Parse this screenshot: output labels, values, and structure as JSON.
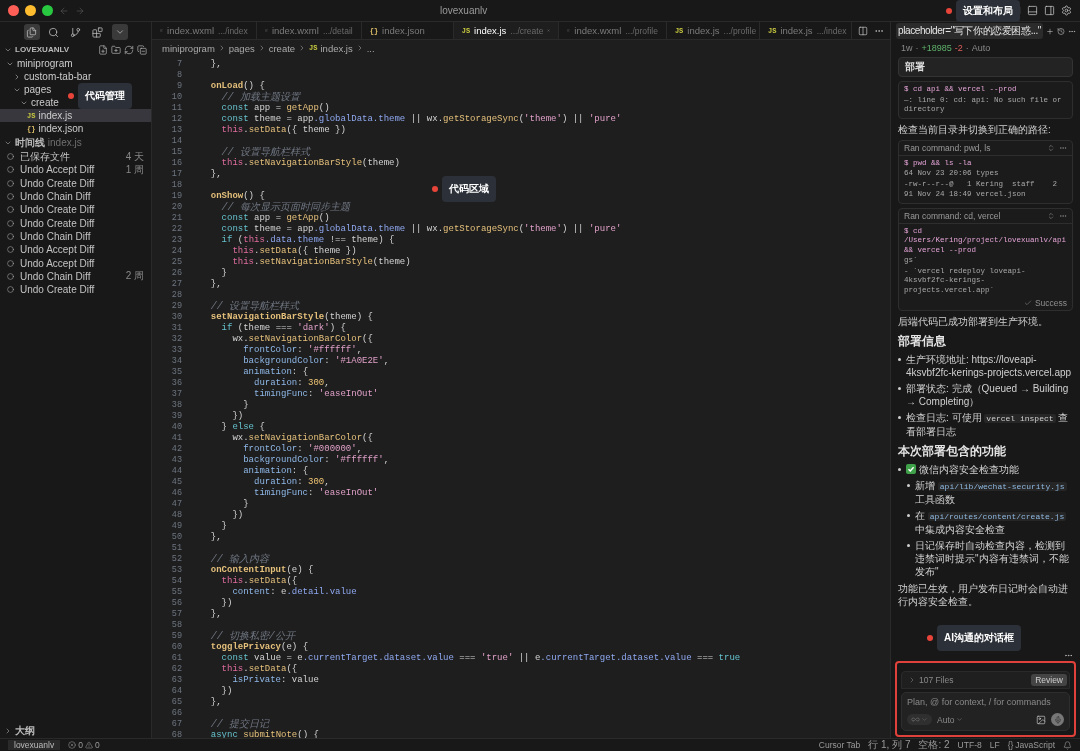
{
  "window": {
    "title": "lovexuanlv"
  },
  "sidebar": {
    "explorer_title": "LOVEXUANLV",
    "callout": "代码管理",
    "tree": [
      {
        "name": "miniprogram",
        "kind": "folder",
        "expanded": true,
        "children": [
          {
            "name": "custom-tab-bar",
            "kind": "folder",
            "expanded": false
          },
          {
            "name": "pages",
            "kind": "folder",
            "expanded": true,
            "children": [
              {
                "name": "create",
                "kind": "folder",
                "expanded": true,
                "children": [
                  {
                    "name": "index.js",
                    "kind": "js",
                    "icon_text": "JS",
                    "selected": true
                  },
                  {
                    "name": "index.json",
                    "kind": "json",
                    "icon_text": "{}",
                    "selected": false
                  }
                ]
              }
            ]
          }
        ]
      }
    ],
    "timeline": {
      "title": "时间线",
      "file": "index.js",
      "items": [
        {
          "label": "已保存文件",
          "time": "4 天"
        },
        {
          "label": "Undo Accept Diff",
          "time": "1 周"
        },
        {
          "label": "Undo Create Diff"
        },
        {
          "label": "Undo Chain Diff"
        },
        {
          "label": "Undo Create Diff"
        },
        {
          "label": "Undo Create Diff"
        },
        {
          "label": "Undo Chain Diff"
        },
        {
          "label": "Undo Accept Diff"
        },
        {
          "label": "Undo Accept Diff"
        },
        {
          "label": "Undo Chain Diff",
          "time": "2 周"
        },
        {
          "label": "Undo Create Diff"
        }
      ]
    },
    "outline": {
      "title": "大纲"
    }
  },
  "editor": {
    "callout": "代码区域",
    "tabs": [
      {
        "name": "index.wxml",
        "path": ".../index",
        "kind": "wxml",
        "selected": false
      },
      {
        "name": "index.wxml",
        "path": ".../detail",
        "kind": "wxml",
        "selected": false
      },
      {
        "name": "index.json",
        "kind": "json",
        "icon_text": "{}",
        "selected": false
      },
      {
        "name": "index.js",
        "path": ".../create",
        "kind": "js",
        "icon_text": "JS",
        "selected": true
      },
      {
        "name": "index.wxml",
        "path": ".../profile",
        "kind": "wxml",
        "selected": false
      },
      {
        "name": "index.js",
        "path": ".../profile",
        "kind": "js",
        "icon_text": "JS",
        "selected": false
      },
      {
        "name": "index.js",
        "path": ".../index",
        "kind": "js",
        "icon_text": "JS",
        "selected": false
      }
    ],
    "breadcrumb": [
      {
        "label": "miniprogram"
      },
      {
        "label": "pages"
      },
      {
        "label": "create"
      },
      {
        "label": "index.js",
        "icon_text": "JS"
      },
      {
        "label": "..."
      }
    ],
    "lines": [
      {
        "n": "7",
        "code": "  },"
      },
      {
        "n": "8"
      },
      {
        "n": "9",
        "code": "  onLoad() {"
      },
      {
        "n": "10",
        "code": "    // 加载主题设置"
      },
      {
        "n": "11",
        "code": "    const app = getApp()"
      },
      {
        "n": "12",
        "code": "    const theme = app.globalData.theme || wx.getStorageSync('theme') || 'pure'"
      },
      {
        "n": "13",
        "code": "    this.setData({ theme })"
      },
      {
        "n": "14"
      },
      {
        "n": "15",
        "code": "    // 设置导航栏样式"
      },
      {
        "n": "16",
        "code": "    this.setNavigationBarStyle(theme)"
      },
      {
        "n": "17",
        "code": "  },"
      },
      {
        "n": "18"
      },
      {
        "n": "19",
        "code": "  onShow() {"
      },
      {
        "n": "20",
        "code": "    // 每次显示页面时同步主题"
      },
      {
        "n": "21",
        "code": "    const app = getApp()"
      },
      {
        "n": "22",
        "code": "    const theme = app.globalData.theme || wx.getStorageSync('theme') || 'pure'"
      },
      {
        "n": "23",
        "code": "    if (this.data.theme !== theme) {"
      },
      {
        "n": "24",
        "code": "      this.setData({ theme })"
      },
      {
        "n": "25",
        "code": "      this.setNavigationBarStyle(theme)"
      },
      {
        "n": "26",
        "code": "    }"
      },
      {
        "n": "27",
        "code": "  },"
      },
      {
        "n": "28"
      },
      {
        "n": "29",
        "code": "  // 设置导航栏样式"
      },
      {
        "n": "30",
        "code": "  setNavigationBarStyle(theme) {"
      },
      {
        "n": "31",
        "code": "    if (theme === 'dark') {"
      },
      {
        "n": "32",
        "code": "      wx.setNavigationBarColor({"
      },
      {
        "n": "33",
        "code": "        frontColor: '#ffffff',"
      },
      {
        "n": "34",
        "code": "        backgroundColor: '#1A0E2E',"
      },
      {
        "n": "35",
        "code": "        animation: {"
      },
      {
        "n": "36",
        "code": "          duration: 300,"
      },
      {
        "n": "37",
        "code": "          timingFunc: 'easeInOut'"
      },
      {
        "n": "38",
        "code": "        }"
      },
      {
        "n": "39",
        "code": "      })"
      },
      {
        "n": "40",
        "code": "    } else {"
      },
      {
        "n": "41",
        "code": "      wx.setNavigationBarColor({"
      },
      {
        "n": "42",
        "code": "        frontColor: '#000000',"
      },
      {
        "n": "43",
        "code": "        backgroundColor: '#ffffff',"
      },
      {
        "n": "44",
        "code": "        animation: {"
      },
      {
        "n": "45",
        "code": "          duration: 300,"
      },
      {
        "n": "46",
        "code": "          timingFunc: 'easeInOut'"
      },
      {
        "n": "47",
        "code": "        }"
      },
      {
        "n": "48",
        "code": "      })"
      },
      {
        "n": "49",
        "code": "    }"
      },
      {
        "n": "50",
        "code": "  },"
      },
      {
        "n": "51"
      },
      {
        "n": "52",
        "code": "  // 输入内容"
      },
      {
        "n": "53",
        "code": "  onContentInput(e) {"
      },
      {
        "n": "54",
        "code": "    this.setData({"
      },
      {
        "n": "55",
        "code": "      content: e.detail.value"
      },
      {
        "n": "56",
        "code": "    })"
      },
      {
        "n": "57",
        "code": "  },"
      },
      {
        "n": "58"
      },
      {
        "n": "59",
        "code": "  // 切换私密/公开"
      },
      {
        "n": "60",
        "code": "  togglePrivacy(e) {"
      },
      {
        "n": "61",
        "code": "    const value = e.currentTarget.dataset.value === 'true' || e.currentTarget.dataset.value === true"
      },
      {
        "n": "62",
        "code": "    this.setData({"
      },
      {
        "n": "63",
        "code": "      isPrivate: value"
      },
      {
        "n": "64",
        "code": "    })"
      },
      {
        "n": "65",
        "code": "  },"
      },
      {
        "n": "66"
      },
      {
        "n": "67",
        "code": "  // 提交日记"
      },
      {
        "n": "68",
        "code": "  async submitNote() {"
      }
    ]
  },
  "chat": {
    "header_callout": "设置和布局",
    "tab": "placeholder=\"写下你的恋爱困惑...\"",
    "meta": {
      "age": "1w",
      "separator": "·",
      "added": "+18985",
      "removed": "-2",
      "mode": "Auto"
    },
    "sticky_title": "部署",
    "blocks": [
      {
        "kind": "terminal",
        "lines": [
          {
            "kind": "command",
            "text": "$ cd api && vercel --prod"
          },
          {
            "kind": "output",
            "text": "—: line 0: cd: api: No such file or directory"
          }
        ]
      },
      {
        "kind": "text",
        "text": "检查当前目录并切换到正确的路径:"
      },
      {
        "kind": "command",
        "title": "Ran command: pwd, ls",
        "lines": [
          {
            "kind": "command",
            "text": "$ pwd && ls -la"
          },
          {
            "kind": "output",
            "text": "64 Nov 23 20:06 types"
          },
          {
            "kind": "output",
            "text": "-rw-r--r--@   1 Kering  staff    2"
          },
          {
            "kind": "output",
            "text": "91 Nov 24 18:49 vercel.json"
          }
        ]
      },
      {
        "kind": "command",
        "title": "Ran command: cd, vercel",
        "lines": [
          {
            "kind": "command",
            "text": "$ cd /Users/Kering/project/lovexuanlv/api && vercel --prod"
          },
          {
            "kind": "output",
            "text": "gs`"
          },
          {
            "kind": "output",
            "text": "- `vercel redeploy loveapi-4ksvbf2fc-kerings-projects.vercel.app`"
          }
        ],
        "status": "Success"
      },
      {
        "kind": "text",
        "text": "后端代码已成功部署到生产环境。"
      },
      {
        "kind": "heading",
        "text": "部署信息"
      },
      {
        "kind": "list",
        "items": [
          {
            "parts": [
              {
                "kind": "text",
                "text": "生产环境地址: https://loveapi-4ksvbf2fc-kerings-projects.vercel.app"
              }
            ]
          },
          {
            "parts": [
              {
                "kind": "text",
                "text": "部署状态: 完成（Queued → Building → Completing）"
              }
            ]
          },
          {
            "parts": [
              {
                "kind": "text",
                "text": "检查日志: 可使用 "
              },
              {
                "kind": "code",
                "text": "vercel inspect"
              },
              {
                "kind": "text",
                "text": " 查看部署日志"
              }
            ]
          }
        ]
      },
      {
        "kind": "heading",
        "text": "本次部署包含的功能"
      },
      {
        "kind": "list",
        "items": [
          {
            "parts": [
              {
                "kind": "check"
              },
              {
                "kind": "text",
                "text": "微信内容安全检查功能"
              }
            ],
            "children": [
              {
                "parts": [
                  {
                    "kind": "text",
                    "text": "新增 "
                  },
                  {
                    "kind": "code",
                    "text": "api/lib/wechat-security.js"
                  },
                  {
                    "kind": "text",
                    "text": " 工具函数"
                  }
                ]
              },
              {
                "parts": [
                  {
                    "kind": "text",
                    "text": "在 "
                  },
                  {
                    "kind": "code",
                    "text": "api/routes/content/create.js"
                  },
                  {
                    "kind": "text",
                    "text": " 中集成内容安全检查"
                  }
                ]
              },
              {
                "parts": [
                  {
                    "kind": "text",
                    "text": "日记保存时自动检查内容，检测到违禁词时提示\"内容有违禁词，不能发布\""
                  }
                ]
              }
            ]
          }
        ]
      },
      {
        "kind": "text",
        "text": "功能已生效，用户发布日记时会自动进行内容安全检查。"
      }
    ],
    "callout": "AI沟通的对话框",
    "composer": {
      "files": "107 Files",
      "review": "Review",
      "placeholder": "Plan, @ for context, / for commands",
      "mode": "Auto",
      "highlighted": true
    }
  },
  "status_bar": {
    "workspace": "lovexuanlv",
    "errors": "0",
    "warnings": "0",
    "items": [
      {
        "text": "Cursor Tab"
      },
      {
        "text": "行 1, 列 7"
      },
      {
        "text": "空格: 2"
      },
      {
        "text": "UTF-8"
      },
      {
        "text": "LF"
      },
      {
        "text": "JavaScript",
        "icon_text": "{}"
      }
    ]
  }
}
